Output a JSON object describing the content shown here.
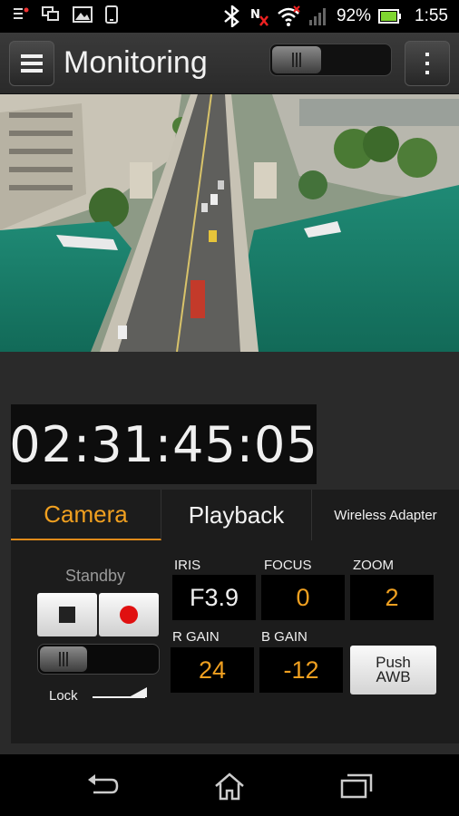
{
  "status_bar": {
    "battery_percent": "92%",
    "time": "1:55",
    "icons": [
      "notification-icon",
      "screen-mirror-icon",
      "gallery-icon",
      "phone-icon",
      "bluetooth-icon",
      "nfc-icon",
      "wifi-icon",
      "signal-icon",
      "battery-icon"
    ]
  },
  "header": {
    "title": "Monitoring",
    "menu_icon": "hamburger-menu-icon",
    "overflow_icon": "more-vert-icon"
  },
  "timecode": "02:31:45:05",
  "tabs": [
    {
      "label": "Camera",
      "active": true
    },
    {
      "label": "Playback",
      "active": false
    },
    {
      "label": "Wireless Adapter",
      "active": false
    }
  ],
  "recording": {
    "status": "Standby",
    "lock_label": "Lock"
  },
  "params": {
    "iris": {
      "label": "IRIS",
      "value": "F3.9"
    },
    "focus": {
      "label": "FOCUS",
      "value": "0"
    },
    "zoom": {
      "label": "ZOOM",
      "value": "2"
    },
    "r_gain": {
      "label": "R GAIN",
      "value": "24"
    },
    "b_gain": {
      "label": "B GAIN",
      "value": "-12"
    },
    "push_awb": {
      "line1": "Push",
      "line2": "AWB"
    }
  },
  "colors": {
    "accent": "#f0a020",
    "record_red": "#e01010"
  },
  "navbar": [
    "back-icon",
    "home-icon",
    "recent-apps-icon"
  ]
}
